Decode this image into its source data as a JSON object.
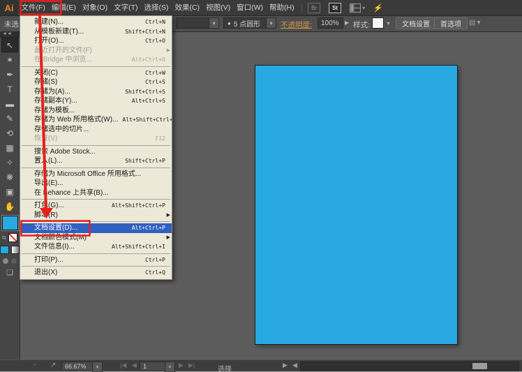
{
  "app": {
    "logo_text": "Ai"
  },
  "menubar": {
    "items": [
      "文件(F)",
      "编辑(E)",
      "对象(O)",
      "文字(T)",
      "选择(S)",
      "效果(C)",
      "视图(V)",
      "窗口(W)",
      "帮助(H)"
    ],
    "bridge_badge": "Br",
    "stock_badge": "St"
  },
  "controlbar": {
    "selection_status": "未选",
    "brush_bullet": "●",
    "brush_value": "5 点圆形",
    "opacity_label": "不透明度:",
    "opacity_value": "100%",
    "style_label": "样式:",
    "document_setup_button": "文档设置",
    "preferences_button": "首选项"
  },
  "toolbar": {
    "collapse_glyph": "◄◄",
    "tools": [
      {
        "name": "selection-tool",
        "glyph": "↖",
        "active": true
      },
      {
        "name": "magic-wand-tool",
        "glyph": "✶"
      },
      {
        "name": "pen-tool",
        "glyph": "✒"
      },
      {
        "name": "type-tool",
        "glyph": "T"
      },
      {
        "name": "rectangle-tool",
        "glyph": "▬"
      },
      {
        "name": "pencil-tool",
        "glyph": "✎"
      },
      {
        "name": "rotate-tool",
        "glyph": "⟲"
      },
      {
        "name": "mesh-tool",
        "glyph": "▦"
      },
      {
        "name": "eyedropper-tool",
        "glyph": "✧"
      },
      {
        "name": "symbol-sprayer-tool",
        "glyph": "❋"
      },
      {
        "name": "artboard-tool",
        "glyph": "▣"
      },
      {
        "name": "hand-tool",
        "glyph": "✋"
      }
    ]
  },
  "file_menu": {
    "items": [
      {
        "label": "新建(N)...",
        "shortcut": "Ctrl+N"
      },
      {
        "label": "从模板新建(T)...",
        "shortcut": "Shift+Ctrl+N"
      },
      {
        "label": "打开(O)...",
        "shortcut": "Ctrl+O"
      },
      {
        "label": "最近打开的文件(F)",
        "disabled": true,
        "submenu": true
      },
      {
        "label": "在 Bridge 中浏览...",
        "shortcut": "Alt+Ctrl+O",
        "disabled": true,
        "separator_after": true
      },
      {
        "label": "关闭(C)",
        "shortcut": "Ctrl+W"
      },
      {
        "label": "存储(S)",
        "shortcut": "Ctrl+S"
      },
      {
        "label": "存储为(A)...",
        "shortcut": "Shift+Ctrl+S"
      },
      {
        "label": "存储副本(Y)...",
        "shortcut": "Alt+Ctrl+S"
      },
      {
        "label": "存储为模板..."
      },
      {
        "label": "存储为 Web 所用格式(W)...",
        "shortcut": "Alt+Shift+Ctrl+S"
      },
      {
        "label": "存储选中的切片..."
      },
      {
        "label": "恢复(V)",
        "shortcut": "F12",
        "disabled": true,
        "separator_after": true
      },
      {
        "label": "搜索 Adobe Stock..."
      },
      {
        "label": "置入(L)...",
        "shortcut": "Shift+Ctrl+P",
        "separator_after": true
      },
      {
        "label": "存储为 Microsoft Office 所用格式..."
      },
      {
        "label": "导出(E)..."
      },
      {
        "label": "在 Behance 上共享(B)...",
        "separator_after": true
      },
      {
        "label": "打包(G)...",
        "shortcut": "Alt+Shift+Ctrl+P"
      },
      {
        "label": "脚本(R)",
        "submenu": true,
        "separator_after": true
      },
      {
        "label": "文档设置(D)...",
        "shortcut": "Alt+Ctrl+P",
        "highlighted": true
      },
      {
        "label": "文档颜色模式(M)",
        "submenu": true
      },
      {
        "label": "文件信息(I)...",
        "shortcut": "Alt+Shift+Ctrl+I",
        "separator_after": true
      },
      {
        "label": "打印(P)...",
        "shortcut": "Ctrl+P",
        "separator_after": true
      },
      {
        "label": "退出(X)",
        "shortcut": "Ctrl+Q"
      }
    ]
  },
  "statusbar": {
    "zoom_value": "66.67%",
    "artboard_value": "1",
    "status_label": "选择"
  },
  "colors": {
    "accent_red": "#e8201c",
    "artboard_blue": "#29a9e1",
    "menu_highlight": "#3161c0",
    "opacity_label_orange": "#d2954a",
    "logo_orange": "#e8891d"
  }
}
